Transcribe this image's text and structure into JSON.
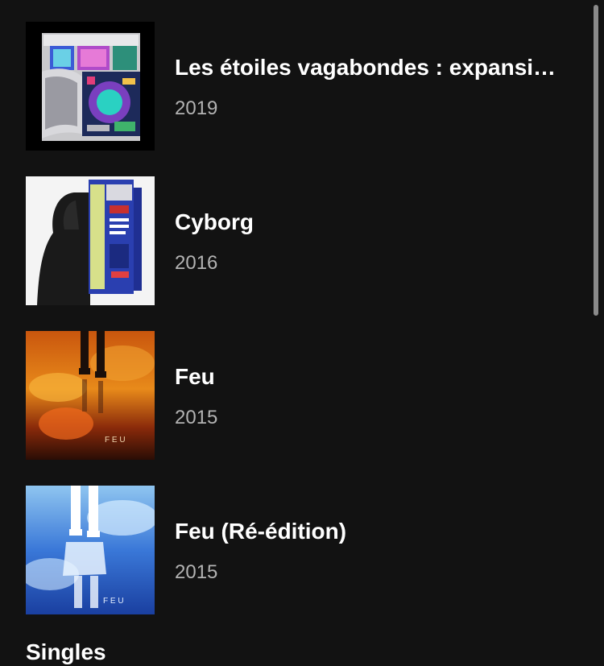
{
  "albums": [
    {
      "title": "Les étoiles vagabondes : expansi…",
      "year": "2019",
      "cover": "etoiles-vagabondes-cover"
    },
    {
      "title": "Cyborg",
      "year": "2016",
      "cover": "cyborg-cover"
    },
    {
      "title": "Feu",
      "year": "2015",
      "cover": "feu-cover"
    },
    {
      "title": "Feu (Ré-édition)",
      "year": "2015",
      "cover": "feu-reedition-cover"
    }
  ],
  "covers_text": {
    "feu": "F E U",
    "feu_reedition": "F E U"
  },
  "next_section": {
    "label": "Singles"
  },
  "colors": {
    "background": "#121212",
    "title": "#ffffff",
    "year": "#b3b3b3",
    "scrollbar": "#8a8a8a"
  }
}
